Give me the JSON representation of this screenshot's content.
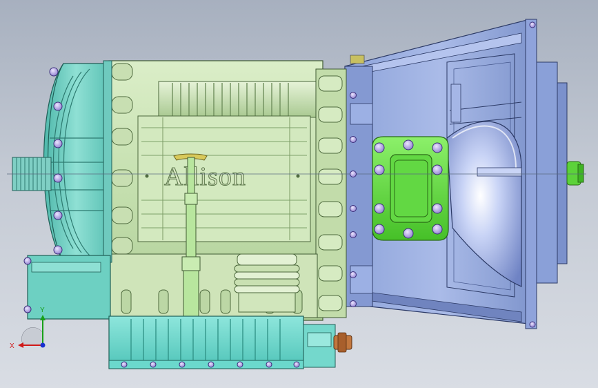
{
  "viewport": {
    "background_top": "#a7b0bf",
    "background_bottom": "#d9dde4"
  },
  "model": {
    "engraved_text": "Allison",
    "parts": [
      {
        "name": "transmission-case",
        "color": "#cfe6b8"
      },
      {
        "name": "input-housing",
        "color": "#7fd0c4"
      },
      {
        "name": "oil-pan",
        "color": "#6fd6cd"
      },
      {
        "name": "bell-housing",
        "color": "#9aaee0"
      },
      {
        "name": "pto-cover-plate",
        "color": "#6ee34a"
      },
      {
        "name": "output-shaft",
        "color": "#5cd23a"
      },
      {
        "name": "fill-tube",
        "color": "#b8e69e"
      },
      {
        "name": "drain-fitting",
        "color": "#b56a3a"
      },
      {
        "name": "bolt-heads",
        "color": "#b7a6e8"
      }
    ]
  },
  "triad": {
    "x_label": "X",
    "y_label": "Y",
    "x_color": "#d01818",
    "y_color": "#18a018",
    "z_color": "#1830d0"
  }
}
